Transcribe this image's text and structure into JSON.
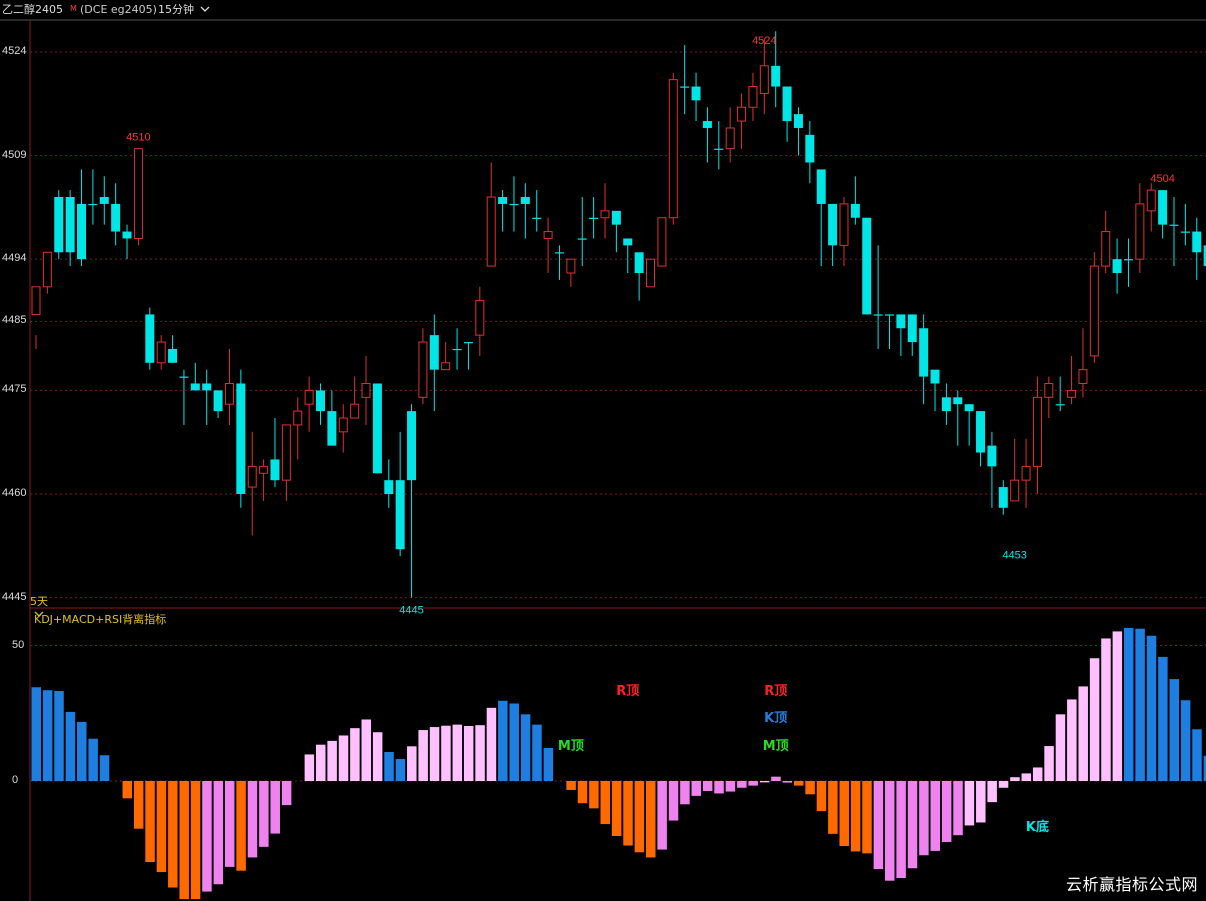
{
  "header": {
    "name": "乙二醇2405",
    "marker": "M",
    "code": "(DCE eg2405)",
    "period": "15分钟",
    "period_icon": "chevron-down-icon"
  },
  "price_axis": {
    "labels": [
      "4524",
      "4509",
      "4494",
      "4485",
      "4475",
      "4460",
      "4445"
    ]
  },
  "days_label": "5天",
  "indicator": {
    "title": "KDJ+MACD+RSI背离指标",
    "title_icon": "chevron-down-icon"
  },
  "ind_axis": {
    "labels": [
      "50",
      "0"
    ]
  },
  "colors": {
    "up": "#e03030",
    "down": "#00e5e5",
    "bar_blue": "#1e7fe0",
    "bar_pink": "#ffc0ff",
    "bar_orange": "#ff6a00",
    "bar_violet": "#ee82ee",
    "red_label": "#ff3030",
    "cyan_label": "#00e5e5",
    "sig_red": "#ff2020",
    "sig_blue": "#1e7fe0",
    "sig_green": "#22dd22",
    "sig_cyan": "#00e5e5"
  },
  "chart_data": [
    {
      "type": "candlestick",
      "title": "乙二醇2405",
      "y_labels": [
        4524,
        4509,
        4494,
        4485,
        4475,
        4460,
        4445
      ],
      "candles": [
        [
          4486,
          4490,
          4483,
          4481
        ],
        [
          4490,
          4495,
          4491,
          4489
        ],
        [
          4503,
          4495,
          4504,
          4494
        ],
        [
          4503,
          4495,
          4504,
          4493
        ],
        [
          4502,
          4494,
          4507,
          4493
        ],
        [
          4502,
          4502,
          4507,
          4499
        ],
        [
          4503,
          4502,
          4506,
          4499
        ],
        [
          4502,
          4498,
          4505,
          4496
        ],
        [
          4498,
          4497,
          4499,
          4494
        ],
        [
          4497,
          4510,
          4510,
          4496
        ],
        [
          4486,
          4479,
          4487,
          4478
        ],
        [
          4479,
          4482,
          4483,
          4478
        ],
        [
          4481,
          4479,
          4483,
          4479
        ],
        [
          4477,
          4477,
          4478,
          4470
        ],
        [
          4476,
          4475,
          4479,
          4475
        ],
        [
          4476,
          4475,
          4478,
          4470
        ],
        [
          4475,
          4472,
          4475,
          4471
        ],
        [
          4473,
          4476,
          4481,
          4470
        ],
        [
          4476,
          4460,
          4478,
          4458
        ],
        [
          4461,
          4464,
          4469,
          4454
        ],
        [
          4463,
          4464,
          4465,
          4459
        ],
        [
          4465,
          4462,
          4471,
          4461
        ],
        [
          4462,
          4470,
          4470,
          4459
        ],
        [
          4470,
          4472,
          4474,
          4465
        ],
        [
          4473,
          4475,
          4477,
          4469
        ],
        [
          4475,
          4472,
          4476,
          4470
        ],
        [
          4472,
          4467,
          4475,
          4468
        ],
        [
          4469,
          4471,
          4473,
          4466
        ],
        [
          4471,
          4473,
          4477,
          4471
        ],
        [
          4474,
          4476,
          4480,
          4470
        ],
        [
          4476,
          4463,
          4476,
          4463
        ],
        [
          4462,
          4460,
          4465,
          4458
        ],
        [
          4462,
          4452,
          4469,
          4451
        ],
        [
          4472,
          4462,
          4473,
          4445
        ],
        [
          4474,
          4482,
          4484,
          4473
        ],
        [
          4483,
          4478,
          4486,
          4472
        ],
        [
          4478,
          4479,
          4482,
          4478
        ],
        [
          4481,
          4481,
          4484,
          4478
        ],
        [
          4482,
          4482,
          4482,
          4478
        ],
        [
          4483,
          4488,
          4490,
          4480
        ],
        [
          4493,
          4503,
          4508,
          4493
        ],
        [
          4503,
          4502,
          4504,
          4498
        ],
        [
          4502,
          4502,
          4506,
          4498
        ],
        [
          4503,
          4502,
          4505,
          4497
        ],
        [
          4500,
          4500,
          4504,
          4498
        ],
        [
          4497,
          4498,
          4500,
          4492
        ],
        [
          4495,
          4495,
          4496,
          4491
        ],
        [
          4492,
          4494,
          4494,
          4490
        ],
        [
          4497,
          4497,
          4503,
          4493
        ],
        [
          4500,
          4500,
          4503,
          4497
        ],
        [
          4500,
          4501,
          4505,
          4497
        ],
        [
          4501,
          4499,
          4499,
          4495
        ],
        [
          4497,
          4496,
          4497,
          4492
        ],
        [
          4495,
          4492,
          4494,
          4488
        ],
        [
          4490,
          4494,
          4493,
          4490
        ],
        [
          4493,
          4500,
          4500,
          4493
        ],
        [
          4500,
          4520,
          4521,
          4499
        ],
        [
          4519,
          4519,
          4525,
          4515
        ],
        [
          4519,
          4517,
          4521,
          4514
        ],
        [
          4514,
          4513,
          4516,
          4508
        ],
        [
          4510,
          4510,
          4514,
          4507
        ],
        [
          4510,
          4513,
          4516,
          4508
        ],
        [
          4514,
          4516,
          4518,
          4510
        ],
        [
          4516,
          4519,
          4521,
          4514
        ],
        [
          4518,
          4522,
          4526,
          4515
        ],
        [
          4522,
          4519,
          4527,
          4516
        ],
        [
          4519,
          4514,
          4516,
          4511
        ],
        [
          4515,
          4513,
          4516,
          4509
        ],
        [
          4512,
          4508,
          4514,
          4505
        ],
        [
          4507,
          4502,
          4503,
          4493
        ],
        [
          4502,
          4496,
          4502,
          4493
        ],
        [
          4496,
          4502,
          4503,
          4493
        ],
        [
          4502,
          4500,
          4506,
          4499
        ],
        [
          4500,
          4486,
          4500,
          4487
        ],
        [
          4486,
          4486,
          4496,
          4481
        ],
        [
          4486,
          4486,
          4486,
          4481
        ],
        [
          4486,
          4484,
          4484,
          4480
        ],
        [
          4486,
          4482,
          4486,
          4480
        ],
        [
          4484,
          4477,
          4486,
          4473
        ],
        [
          4478,
          4476,
          4478,
          4472
        ],
        [
          4474,
          4472,
          4476,
          4470
        ],
        [
          4474,
          4473,
          4475,
          4467
        ],
        [
          4473,
          4472,
          4473,
          4467
        ],
        [
          4472,
          4466,
          4472,
          4464
        ],
        [
          4467,
          4464,
          4469,
          4458
        ],
        [
          4461,
          4458,
          4462,
          4457
        ],
        [
          4459,
          4462,
          4468,
          4459
        ],
        [
          4462,
          4464,
          4468,
          4458
        ],
        [
          4464,
          4474,
          4477,
          4460
        ],
        [
          4474,
          4476,
          4477,
          4471
        ],
        [
          4473,
          4473,
          4477,
          4472
        ],
        [
          4474,
          4475,
          4480,
          4473
        ],
        [
          4476,
          4478,
          4484,
          4474
        ],
        [
          4480,
          4493,
          4495,
          4479
        ],
        [
          4493,
          4498,
          4501,
          4492
        ],
        [
          4494,
          4492,
          4497,
          4489
        ],
        [
          4494,
          4494,
          4497,
          4490
        ],
        [
          4494,
          4502,
          4505,
          4492
        ],
        [
          4501,
          4504,
          4505,
          4498
        ],
        [
          4504,
          4499,
          4502,
          4497
        ],
        [
          4499,
          4499,
          4503,
          4493
        ],
        [
          4498,
          4498,
          4502,
          4496
        ],
        [
          4498,
          4495,
          4500,
          4491
        ],
        [
          4496,
          4493,
          4495,
          4487
        ]
      ],
      "annotations": [
        {
          "label": "4510",
          "index": 9,
          "value": 4510,
          "kind": "high"
        },
        {
          "label": "4445",
          "index": 33,
          "value": 4445,
          "kind": "low"
        },
        {
          "label": "4524",
          "index": 64,
          "value": 4524,
          "kind": "high"
        },
        {
          "label": "4453",
          "index": 86,
          "value": 4453,
          "kind": "low"
        },
        {
          "label": "4504",
          "index": 99,
          "value": 4504,
          "kind": "high"
        }
      ]
    },
    {
      "type": "bar",
      "title": "KDJ+MACD+RSI背离指标",
      "y_labels": [
        50,
        0
      ],
      "values": [
        34.6,
        33.5,
        33.2,
        25.5,
        21.8,
        15.6,
        9.5,
        0,
        -6.4,
        -17.6,
        -29.9,
        -33.6,
        -39.3,
        -43.6,
        -43.6,
        -40.8,
        -38.1,
        -31.7,
        -33.1,
        -28.2,
        -24.3,
        -19.4,
        -8.9,
        0,
        9.8,
        13.4,
        14.8,
        16.8,
        19.5,
        22.7,
        18.0,
        10.7,
        8.1,
        12.8,
        18.8,
        19.9,
        20.4,
        20.8,
        20.3,
        20.6,
        27.0,
        29.6,
        28.6,
        24.6,
        20.8,
        12.2,
        2.8,
        -3.3,
        -8.2,
        -10.1,
        -15.9,
        -20.3,
        -23.8,
        -26.3,
        -28.2,
        -25.3,
        -14.6,
        -8.6,
        -5.5,
        -3.7,
        -4.6,
        -3.9,
        -2.5,
        -1.7,
        -0.5,
        1.6,
        -0.6,
        -1.7,
        -4.9,
        -11.1,
        -19.5,
        -24.0,
        -26.0,
        -26.7,
        -32.5,
        -36.8,
        -35.8,
        -32.2,
        -27.4,
        -25.8,
        -22.5,
        -20.0,
        -16.4,
        -15.3,
        -7.8,
        -2.5,
        1.4,
        2.8,
        5.0,
        12.9,
        24.6,
        30.1,
        34.9,
        45.3,
        52.6,
        55.2,
        56.5,
        56.2,
        53.6,
        45.8,
        37.6,
        29.8,
        19.1,
        9.3
      ],
      "color_codes": "BBBBBBB.OOOOOOOVVVOVVVV.PPPPPPPBBPPPPPPPPBBBBB.OOOOOOOOVVVVVVVVVPVVOOOOOOOVVVVVVVVPPPPPPPPPPPPPPBBBBBBBB",
      "signals": [
        {
          "text": "R顶",
          "color": "sig_red",
          "index": 52
        },
        {
          "text": "M顶",
          "color": "sig_green",
          "index": 47
        },
        {
          "text": "R顶",
          "color": "sig_red",
          "index": 65
        },
        {
          "text": "K顶",
          "color": "sig_blue",
          "index": 65
        },
        {
          "text": "M顶",
          "color": "sig_green",
          "index": 65
        },
        {
          "text": "K底",
          "color": "sig_cyan",
          "index": 88
        }
      ]
    }
  ],
  "watermark": "云析赢指标公式网"
}
